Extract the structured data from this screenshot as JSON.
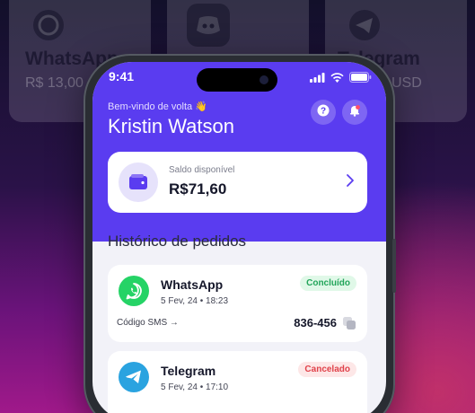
{
  "background_cards": [
    {
      "title": "WhatsApp",
      "subtitle": "R$ 13,00",
      "icon": "whatsapp-icon"
    },
    {
      "title": "",
      "subtitle": "",
      "icon": "discord-icon"
    },
    {
      "title": "Telegram",
      "subtitle": "USD",
      "icon": "telegram-icon"
    }
  ],
  "status_bar": {
    "time": "9:41"
  },
  "header": {
    "welcome": "Bem-vindo de volta 👋",
    "user_name": "Kristin Watson"
  },
  "balance": {
    "label": "Saldo disponível",
    "value": "R$71,60"
  },
  "orders_section": {
    "title": "Histórico de pedidos"
  },
  "orders": [
    {
      "app": "WhatsApp",
      "date": "5 Fev, 24 • 18:23",
      "status": "Concluído",
      "sms_label": "Código SMS →",
      "code": "836-456"
    },
    {
      "app": "Telegram",
      "date": "5 Fev, 24 • 17:10",
      "status": "Cancelado"
    }
  ],
  "colors": {
    "accent": "#5a3cf0",
    "success": "#22a55a",
    "error": "#e0424a",
    "whatsapp": "#25d366",
    "telegram": "#2aa3e0",
    "discord": "#5865f2"
  }
}
